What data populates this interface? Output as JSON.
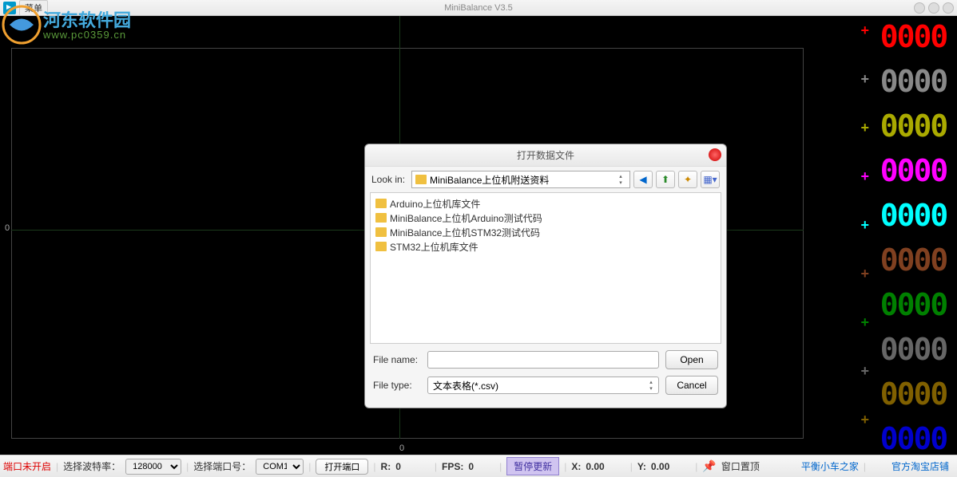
{
  "titlebar": {
    "menu": "菜单",
    "title": "MiniBalance V3.5"
  },
  "watermark": {
    "text": "河东软件园",
    "url": "www.pc0359.cn"
  },
  "plot": {
    "zero_y": "0",
    "zero_x": "0"
  },
  "channels": [
    {
      "color": "#ff0000",
      "value": "0000"
    },
    {
      "color": "#888888",
      "value": "0000"
    },
    {
      "color": "#aaaa00",
      "value": "0000"
    },
    {
      "color": "#ff00ff",
      "value": "0000"
    },
    {
      "color": "#00ffff",
      "value": "0000"
    },
    {
      "color": "#804020",
      "value": "0000"
    },
    {
      "color": "#008000",
      "value": "0000"
    },
    {
      "color": "#666666",
      "value": "0000"
    },
    {
      "color": "#806000",
      "value": "0000"
    },
    {
      "color": "#0000cc",
      "value": "0000"
    }
  ],
  "statusbar": {
    "port_status": "端口未开启",
    "baud_label": "选择波特率：",
    "baud_value": "128000",
    "port_label": "选择端口号：",
    "port_value": "COM1",
    "open_port": "打开端口",
    "r_label": "R:",
    "r_value": "0",
    "fps_label": "FPS:",
    "fps_value": "0",
    "pause": "暂停更新",
    "x_label": "X:",
    "x_value": "0.00",
    "y_label": "Y:",
    "y_value": "0.00",
    "topmost": "窗口置顶",
    "link1": "平衡小车之家",
    "link2": "官方淘宝店铺"
  },
  "dialog": {
    "title": "打开数据文件",
    "lookin_label": "Look in:",
    "lookin_value": "MiniBalance上位机附送资料",
    "files": [
      "Arduino上位机库文件",
      "MiniBalance上位机Arduino测试代码",
      "MiniBalance上位机STM32测试代码",
      "STM32上位机库文件"
    ],
    "filename_label": "File name:",
    "filename_value": "",
    "filetype_label": "File type:",
    "filetype_value": "文本表格(*.csv)",
    "open": "Open",
    "cancel": "Cancel"
  }
}
